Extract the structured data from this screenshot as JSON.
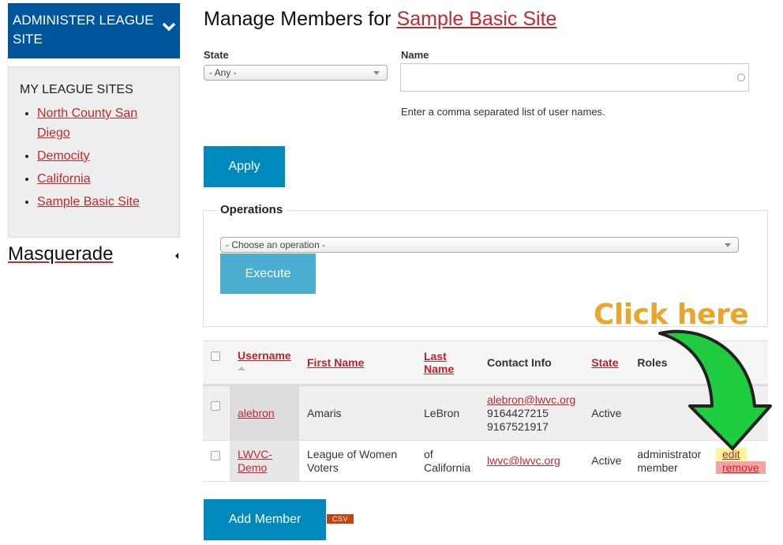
{
  "sidebar": {
    "admin_title": "ADMINISTER LEAGUE SITE",
    "sites_heading": "MY LEAGUE SITES",
    "sites": [
      {
        "label": "North County San Diego"
      },
      {
        "label": "Democity"
      },
      {
        "label": "California"
      },
      {
        "label": "Sample Basic Site"
      }
    ],
    "masquerade_label": "Masquerade"
  },
  "main": {
    "title_prefix": "Manage Members for ",
    "title_link": "Sample Basic Site",
    "filters": {
      "state_label": "State",
      "state_value": "- Any -",
      "name_label": "Name",
      "name_value": "",
      "name_hint": "Enter a comma separated list of user names.",
      "apply_label": "Apply"
    },
    "operations": {
      "legend": "Operations",
      "select_value": "- Choose an operation -",
      "execute_label": "Execute"
    },
    "table": {
      "headers": {
        "username": "Username",
        "first_name": "First Name",
        "last_name": "Last Name",
        "contact_info": "Contact Info",
        "state": "State",
        "roles": "Roles"
      },
      "rows": [
        {
          "username": "alebron",
          "first_name": "Amaris",
          "last_name": "LeBron",
          "email": "alebron@lwvc.org",
          "phone1": "9164427215",
          "phone2": "9167521917",
          "state": "Active",
          "roles": ""
        },
        {
          "username": "LWVC-Demo",
          "first_name": "League of Women Voters",
          "last_name": "of California",
          "email": "lwvc@lwvc.org",
          "state": "Active",
          "role1": "administrator",
          "role2": "member",
          "edit_label": "edit",
          "remove_label": "remove"
        }
      ]
    },
    "add_member_label": "Add Member",
    "csv_label": "CSV"
  },
  "annotation": {
    "text": "Click here",
    "arrow_color": "#1fcc3f",
    "text_color": "#eaa52b"
  }
}
